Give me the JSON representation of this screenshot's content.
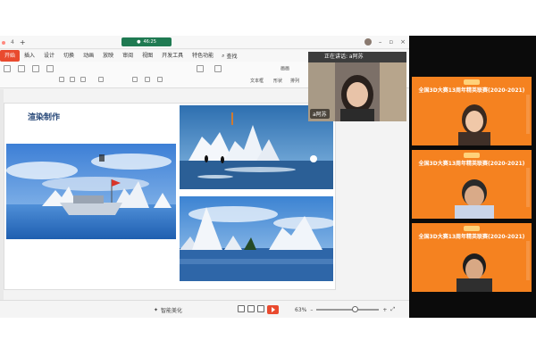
{
  "titlebar": {
    "tab_count": "4",
    "center_label": "46:25",
    "window_controls": [
      "minimize",
      "restore",
      "close"
    ]
  },
  "ribbon": {
    "tabs": [
      "开始",
      "插入",
      "设计",
      "切换",
      "动画",
      "放映",
      "审阅",
      "视图",
      "开发工具",
      "特色功能"
    ],
    "active_tab": "开始",
    "search_label": "查找",
    "tools": [
      "画画",
      "文本框",
      "形状",
      "排列"
    ]
  },
  "slide": {
    "title": "渲染制作"
  },
  "statusbar": {
    "ai_label": "智能美化",
    "zoom": "63%",
    "zoom_level": 0.63
  },
  "speaker": {
    "header": "正在讲话: a阿苏",
    "name": "a阿苏"
  },
  "participants": [
    {
      "banner": "全国3D大赛13周年精英联赛(2020-2021)"
    },
    {
      "banner": "全国3D大赛13周年精英联赛(2020-2021)"
    },
    {
      "banner": "全国3D大赛13周年精英联赛(2020-2021)"
    }
  ],
  "colors": {
    "accent": "#e94a2e",
    "panel_orange": "#f58220",
    "title_blue": "#2a4a7a"
  }
}
